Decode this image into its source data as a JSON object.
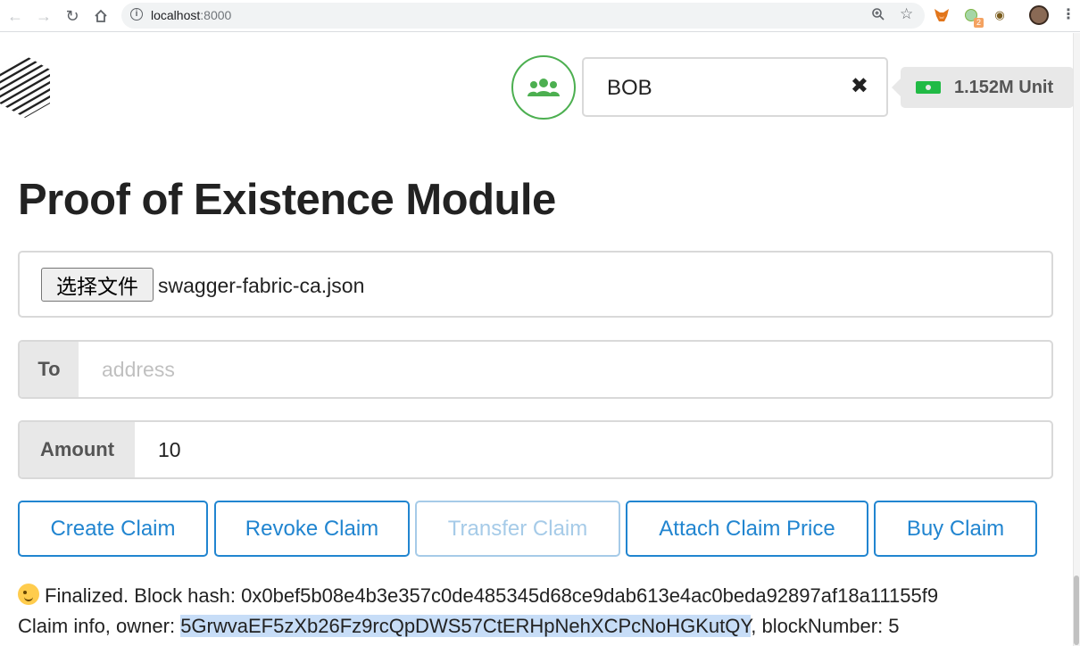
{
  "browser": {
    "url_host": "localhost",
    "url_port": ":8000",
    "extension_badge": "2"
  },
  "header": {
    "account_name": "BOB",
    "clear_icon": "×",
    "balance": "1.152M Unit"
  },
  "page": {
    "title": "Proof of Existence Module"
  },
  "file_input": {
    "button_label": "选择文件",
    "file_name": "swagger-fabric-ca.json"
  },
  "to_field": {
    "label": "To",
    "placeholder": "address",
    "value": ""
  },
  "amount_field": {
    "label": "Amount",
    "value": "10"
  },
  "actions": {
    "create": "Create Claim",
    "revoke": "Revoke Claim",
    "transfer": "Transfer Claim",
    "attach_price": "Attach Claim Price",
    "buy": "Buy Claim"
  },
  "status": {
    "line1": "Finalized. Block hash: 0x0bef5b08e4b3e357c0de485345d68ce9dab613e4ac0beda92897af18a11155f9",
    "line2_prefix": "Claim info, owner: ",
    "owner": "5GrwvaEF5zXb26Fz9rcQpDWS57CtERHpNehXCPcNoHGKutQY",
    "line2_suffix": ", blockNumber: 5"
  },
  "colors": {
    "primary": "#2185d0",
    "primary_disabled": "#a6cbe8",
    "account_ring": "#4caf50",
    "money": "#21ba45"
  },
  "icons": [
    "back-arrow-icon",
    "forward-arrow-icon",
    "reload-icon",
    "home-icon",
    "info-icon",
    "zoom-icon",
    "star-icon",
    "metamask-icon",
    "extension-icon",
    "extension-icon-2",
    "profile-avatar",
    "menu-kebab-icon",
    "logo-icon",
    "users-icon",
    "close-icon",
    "money-bill-icon",
    "wink-emoji-icon"
  ]
}
